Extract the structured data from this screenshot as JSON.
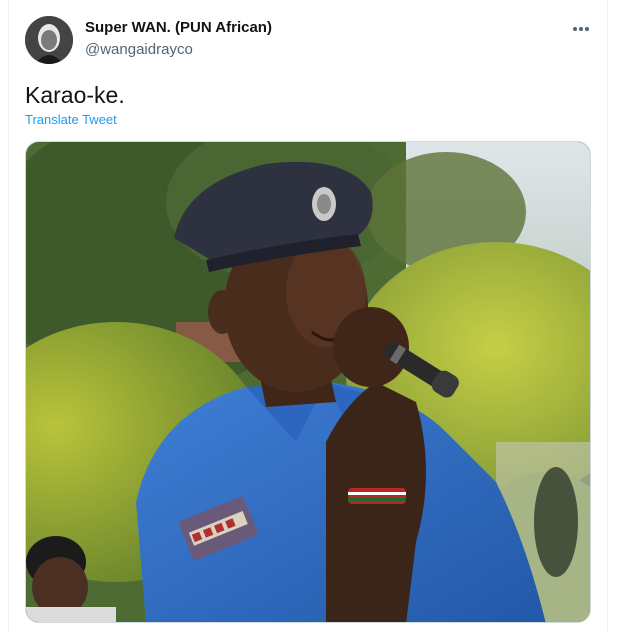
{
  "tweet": {
    "author": {
      "display_name": "Super WAN. (PUN African)",
      "handle": "@wangaidrayco",
      "avatar_icon": "avatar-photo"
    },
    "text": "Karao-ke.",
    "translate_label": "Translate Tweet",
    "more_icon": "ellipsis-icon",
    "media": {
      "type": "photo",
      "subject": "police-officer-with-microphone"
    }
  },
  "colors": {
    "text_primary": "#0f1419",
    "text_secondary": "#536471",
    "link": "#1d9bf0",
    "border": "#cfd9de"
  }
}
